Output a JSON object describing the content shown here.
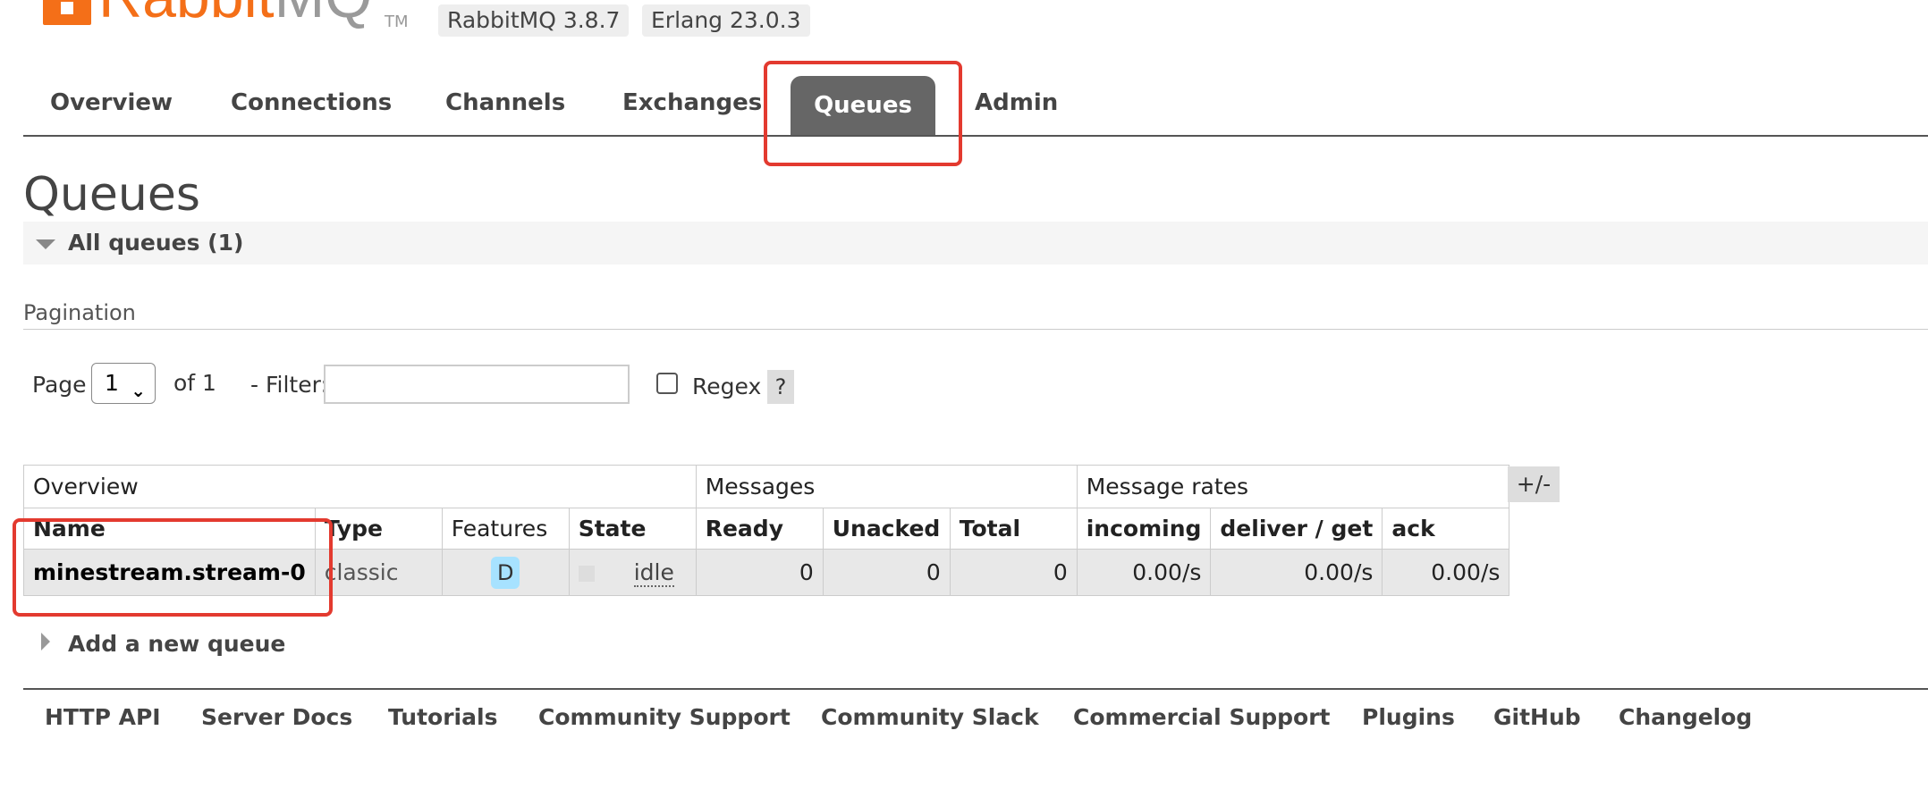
{
  "header": {
    "logo_rabbit": "Rabbit",
    "logo_mq": "MQ",
    "logo_tm": "TM",
    "rabbitmq_version": "RabbitMQ 3.8.7",
    "erlang_version": "Erlang 23.0.3"
  },
  "nav": {
    "tabs": [
      "Overview",
      "Connections",
      "Channels",
      "Exchanges",
      "Queues",
      "Admin"
    ],
    "active": "Queues"
  },
  "page": {
    "title": "Queues",
    "section_label": "All queues (1)"
  },
  "pagination": {
    "heading": "Pagination",
    "page_label": "Page",
    "page_value": "1",
    "of_label": "of 1",
    "filter_label": "- Filter:",
    "filter_value": "",
    "regex_label": "Regex",
    "help_label": "?"
  },
  "table": {
    "groups": [
      "Overview",
      "Messages",
      "Message rates"
    ],
    "columns": [
      "Name",
      "Type",
      "Features",
      "State",
      "Ready",
      "Unacked",
      "Total",
      "incoming",
      "deliver / get",
      "ack"
    ],
    "toggle_label": "+/-",
    "rows": [
      {
        "name": "minestream.stream-0",
        "type": "classic",
        "features": "D",
        "state": "idle",
        "ready": "0",
        "unacked": "0",
        "total": "0",
        "incoming": "0.00/s",
        "deliver_get": "0.00/s",
        "ack": "0.00/s"
      }
    ]
  },
  "add_queue_label": "Add a new queue",
  "footer": {
    "links": [
      "HTTP API",
      "Server Docs",
      "Tutorials",
      "Community Support",
      "Community Slack",
      "Commercial Support",
      "Plugins",
      "GitHub",
      "Changelog"
    ]
  },
  "colors": {
    "brand_orange": "#f46f18",
    "active_tab_bg": "#666666",
    "annotation_red": "#e33a2f",
    "feature_badge": "#a7e2ff"
  }
}
